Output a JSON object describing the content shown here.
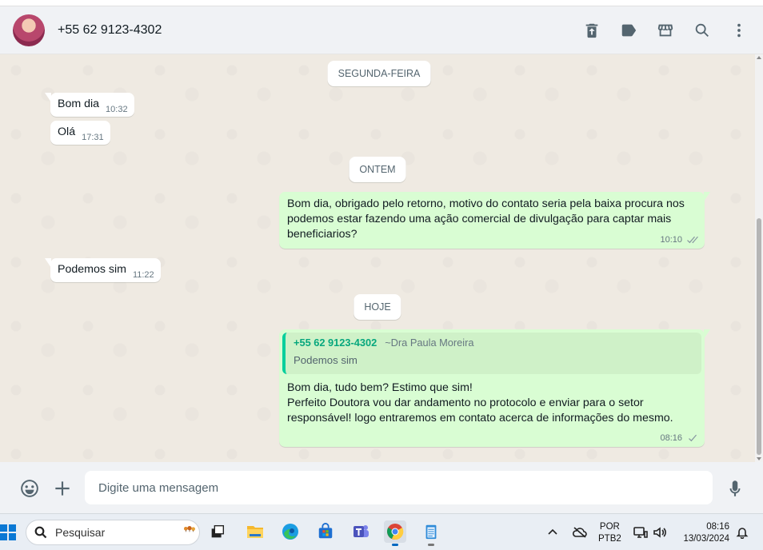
{
  "header": {
    "contact_name": "+55 62 9123-4302",
    "icons": [
      "delete-icon",
      "label-icon",
      "catalog-icon",
      "search-icon",
      "menu-icon"
    ]
  },
  "chat": {
    "day_separators": [
      "SEGUNDA-FEIRA",
      "ONTEM",
      "HOJE"
    ],
    "messages": [
      {
        "direction": "in",
        "text": "Bom dia",
        "time": "10:32"
      },
      {
        "direction": "in",
        "text": "Olá",
        "time": "17:31"
      },
      {
        "direction": "out",
        "text": "Bom dia, obrigado pelo retorno, motivo do contato seria pela baixa procura nos\npodemos estar fazendo uma ação comercial de divulgação para captar mais\nbeneficiarios?",
        "time": "10:10",
        "status": "read"
      },
      {
        "direction": "in",
        "text": "Podemos sim",
        "time": "11:22"
      },
      {
        "direction": "out",
        "quote": {
          "author": "+55 62 9123-4302",
          "push_name": "~Dra Paula Moreira",
          "text": "Podemos sim"
        },
        "text": "Bom dia, tudo bem? Estimo que sim!\nPerfeito Doutora vou dar andamento no protocolo e enviar para o setor\nresponsável! logo entraremos em contato acerca de informações do mesmo.",
        "time": "08:16",
        "status": "sent"
      }
    ]
  },
  "composer": {
    "placeholder": "Digite uma mensagem",
    "icons": [
      "emoji-icon",
      "attach-icon",
      "microphone-icon"
    ]
  },
  "taskbar": {
    "search_label": "Pesquisar",
    "apps": [
      "task-view",
      "file-explorer",
      "edge",
      "microsoft-store",
      "teams",
      "chrome",
      "notepad"
    ],
    "language_line1": "POR",
    "language_line2": "PTB2",
    "time": "08:16",
    "date": "13/03/2024"
  }
}
